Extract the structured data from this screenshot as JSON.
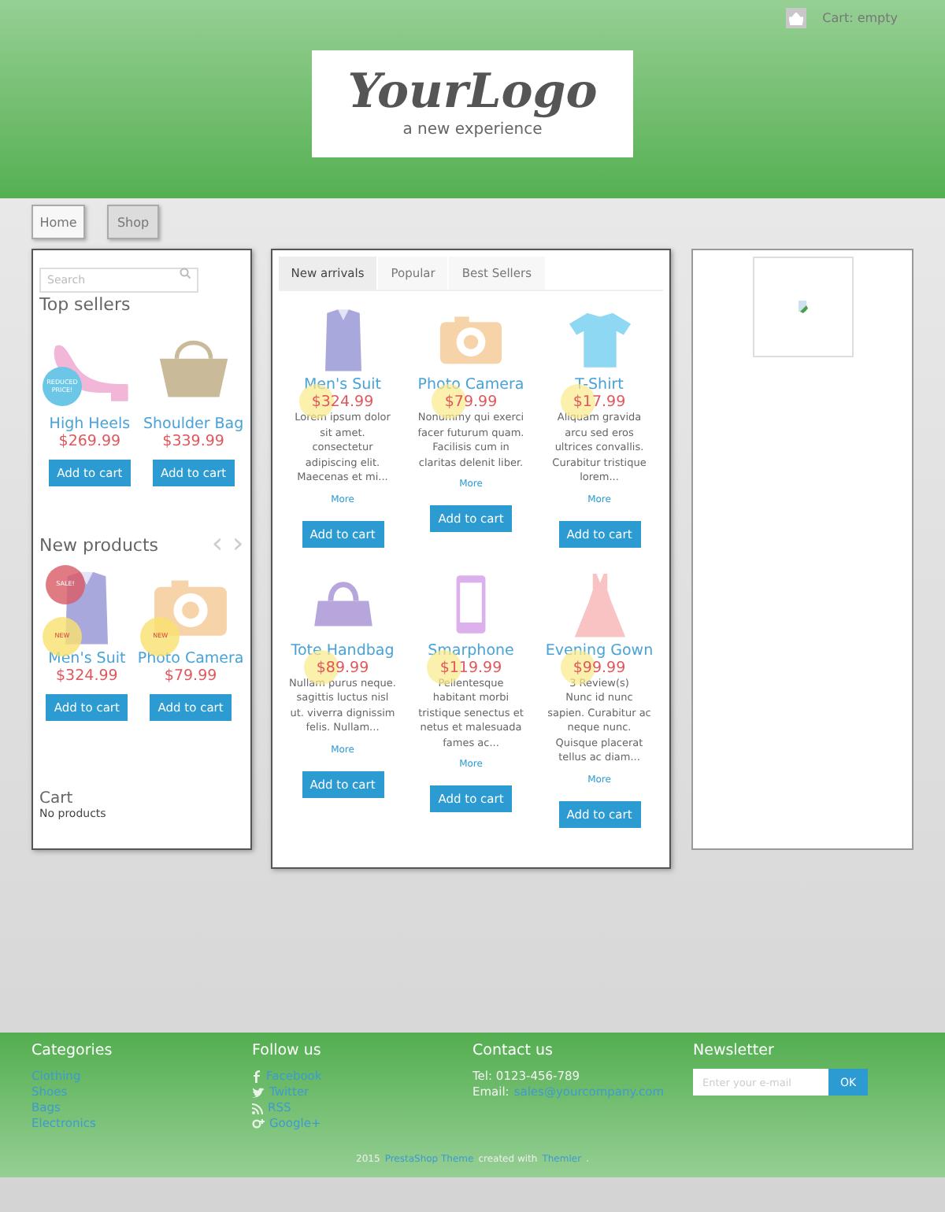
{
  "header": {
    "cart_label": "Cart: empty",
    "logo": {
      "title": "YourLogo",
      "tagline": "a new experience"
    }
  },
  "nav": [
    {
      "label": "Home",
      "selected": true
    },
    {
      "label": "Shop",
      "selected": false
    }
  ],
  "left": {
    "search": {
      "placeholder": "Search"
    },
    "top_sellers": {
      "title": "Top sellers",
      "products": [
        {
          "name": "High Heels",
          "price": "$269.99",
          "kind": "heel",
          "badges": [
            {
              "kind": "reduced",
              "text": "REDUCED PRICE!"
            }
          ],
          "button": "Add to cart"
        },
        {
          "name": "Shoulder Bag",
          "price": "$339.99",
          "kind": "bag",
          "button": "Add to cart"
        }
      ]
    },
    "new_products": {
      "title": "New products",
      "prev": "‹",
      "next": "›",
      "products": [
        {
          "name": "Men's Suit",
          "price": "$324.99",
          "kind": "suit",
          "badges": [
            {
              "kind": "sale",
              "text": "SALE!"
            },
            {
              "kind": "new",
              "text": "NEW"
            }
          ],
          "button": "Add to cart"
        },
        {
          "name": "Photo Camera",
          "price": "$79.99",
          "kind": "camera",
          "badges": [
            {
              "kind": "new",
              "text": "NEW"
            }
          ],
          "button": "Add to cart"
        }
      ]
    },
    "cart": {
      "title": "Cart",
      "text": "No products"
    }
  },
  "tabs": [
    {
      "label": "New arrivals",
      "selected": true
    },
    {
      "label": "Popular",
      "selected": false
    },
    {
      "label": "Best Sellers",
      "selected": false
    }
  ],
  "products": [
    {
      "name": "Men's Suit",
      "price": "$324.99",
      "kind": "suit",
      "new": true,
      "description": "Lorem ipsum dolor sit amet. consectetur adipiscing elit. Maecenas et mi...",
      "more": "More",
      "button": "Add to cart"
    },
    {
      "name": "Photo Camera",
      "price": "$79.99",
      "kind": "camera",
      "new": true,
      "description": "Nonummy qui exerci facer futurum quam. Facilisis cum in claritas delenit liber.",
      "more": "More",
      "button": "Add to cart"
    },
    {
      "name": "T-Shirt",
      "price": "$17.99",
      "kind": "tshirt",
      "new": true,
      "description": "Aliquam gravida arcu sed eros ultrices convallis. Curabitur tristique lorem...",
      "more": "More",
      "button": "Add to cart"
    },
    {
      "name": "Tote Handbag",
      "price": "$89.99",
      "kind": "handbag",
      "new": true,
      "description": "Nullam purus neque. sagittis luctus nisl ut. viverra dignissim felis. Nullam...",
      "more": "More",
      "button": "Add to cart"
    },
    {
      "name": "Smarphone",
      "price": "$119.99",
      "kind": "phone",
      "new": true,
      "description": "Pellentesque habitant morbi tristique senectus et netus et malesuada fames ac...",
      "more": "More",
      "button": "Add to cart"
    },
    {
      "name": "Evening Gown",
      "price": "$99.99",
      "kind": "dress",
      "new": true,
      "reviews": "3 Review(s)",
      "description": "Nunc id nunc sapien. Curabitur ac neque nunc. Quisque placerat tellus ac diam...",
      "more": "More",
      "button": "Add to cart"
    }
  ],
  "footer": {
    "categories": {
      "title": "Categories",
      "links": [
        "Clothing",
        "Shoes",
        "Bags",
        "Electronics"
      ]
    },
    "follow": {
      "title": "Follow us",
      "links": [
        {
          "kind": "facebook",
          "label": "Facebook"
        },
        {
          "kind": "twitter",
          "label": "Twitter"
        },
        {
          "kind": "rss",
          "label": "RSS"
        },
        {
          "kind": "google",
          "label": "Google+"
        }
      ]
    },
    "contact": {
      "title": "Contact us",
      "phone": "Tel: 0123-456-789",
      "email_label": "Email:",
      "email": "sales@yourcompany.com"
    },
    "newsletter": {
      "title": "Newsletter",
      "placeholder": "Enter your e-mail",
      "button": "OK"
    },
    "credit": {
      "year": "2015",
      "theme_link": "PrestaShop Theme",
      "middle": "created with",
      "maker_link": "Themler",
      "end": "."
    }
  }
}
